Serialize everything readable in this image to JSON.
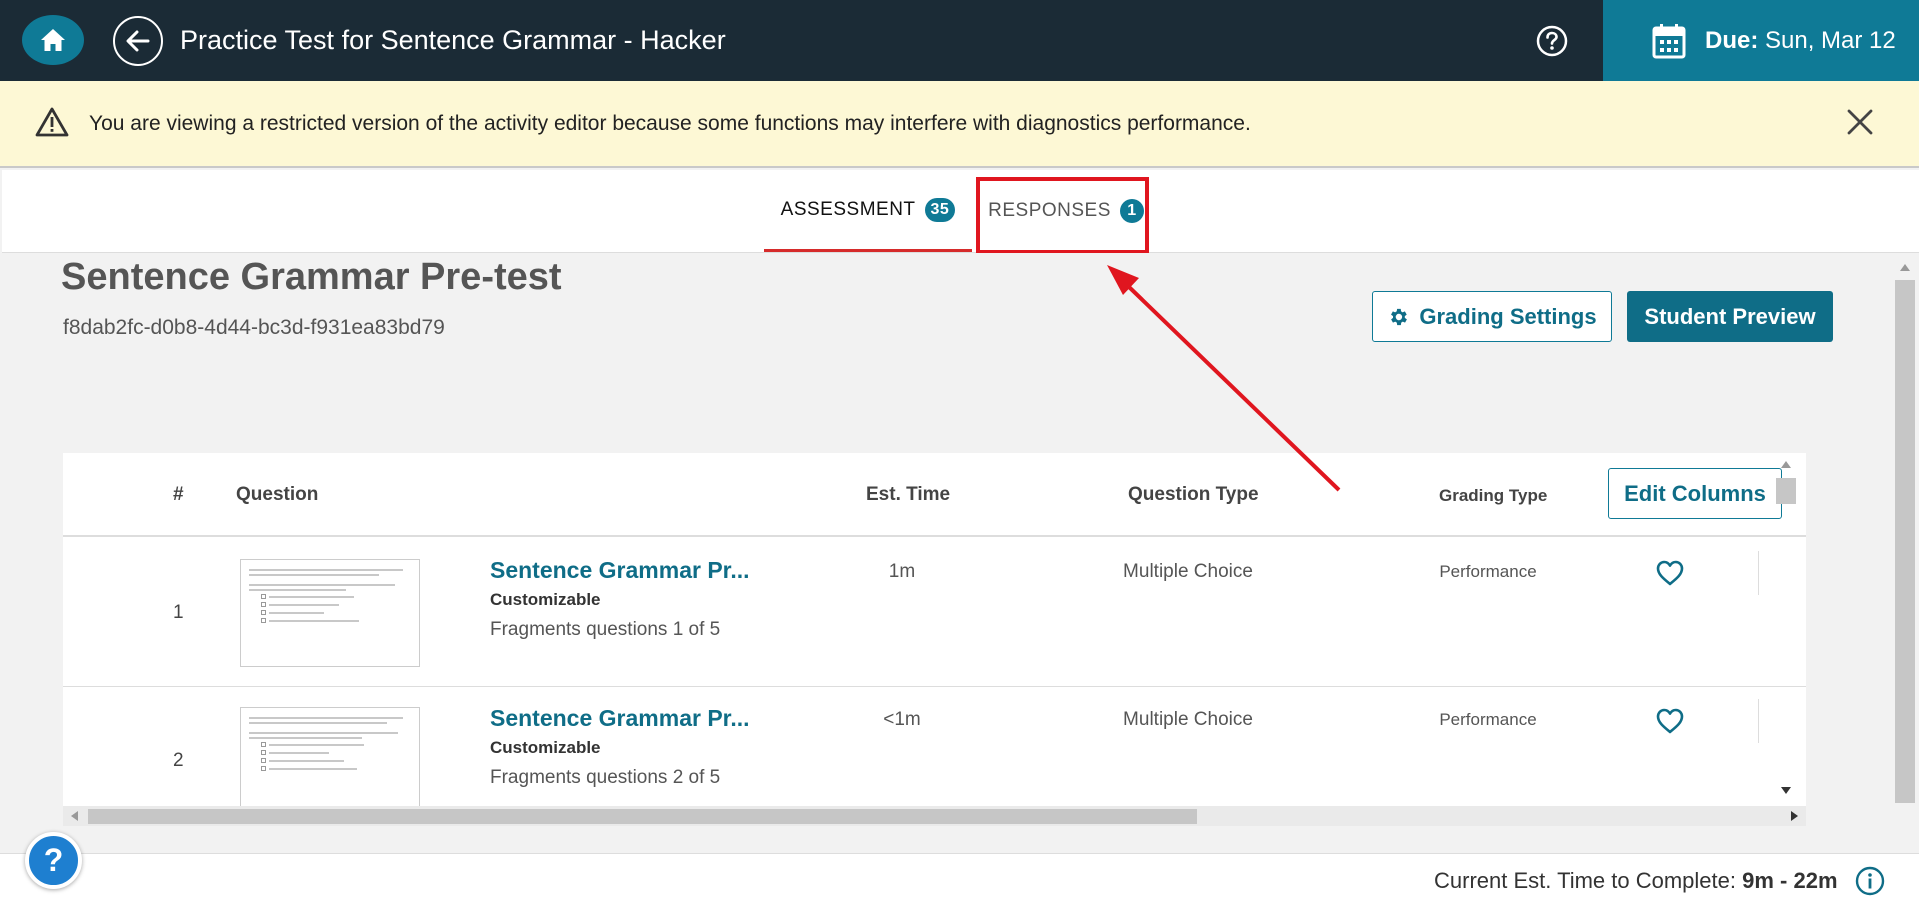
{
  "header": {
    "title": "Practice Test for Sentence Grammar - Hacker",
    "due_label": "Due:",
    "due_date": "Sun, Mar 12"
  },
  "banner": {
    "message": "You are viewing a restricted version of the activity editor because some functions may interfere with diagnostics performance."
  },
  "tabs": [
    {
      "label": "ASSESSMENT",
      "count": "35",
      "active": true
    },
    {
      "label": "RESPONSES",
      "count": "1",
      "active": false
    }
  ],
  "activity": {
    "title": "Sentence Grammar Pre-test",
    "id": "f8dab2fc-d0b8-4d44-bc3d-f931ea83bd79",
    "grading_settings_label": "Grading Settings",
    "student_preview_label": "Student Preview"
  },
  "table": {
    "columns": [
      "#",
      "Question",
      "Est. Time",
      "Question Type",
      "Grading Type"
    ],
    "edit_columns_label": "Edit Columns",
    "rows": [
      {
        "num": "1",
        "title": "Sentence Grammar Pr...",
        "subtitle": "Customizable",
        "fragment": "Fragments questions 1 of 5",
        "est_time": "1m",
        "question_type": "Multiple Choice",
        "grading_type": "Performance"
      },
      {
        "num": "2",
        "title": "Sentence Grammar Pr...",
        "subtitle": "Customizable",
        "fragment": "Fragments questions 2 of 5",
        "est_time": "<1m",
        "question_type": "Multiple Choice",
        "grading_type": "Performance"
      }
    ]
  },
  "footer": {
    "est_label": "Current Est. Time to Complete:",
    "est_value": "9m - 22m",
    "help_label": "?"
  },
  "icons": {
    "home": "home-icon",
    "back": "arrow-left-icon",
    "help": "question-circle-icon",
    "calendar": "calendar-icon",
    "warning": "warning-triangle-icon",
    "close": "close-icon",
    "gear": "gear-icon",
    "heart": "heart-outline-icon",
    "info": "info-circle-icon"
  },
  "colors": {
    "topbar": "#1b2b36",
    "accent": "#0f7a96",
    "banner": "#fdf8d5",
    "active_tab_underline": "#d62b2b",
    "annotation": "#e0161f"
  }
}
